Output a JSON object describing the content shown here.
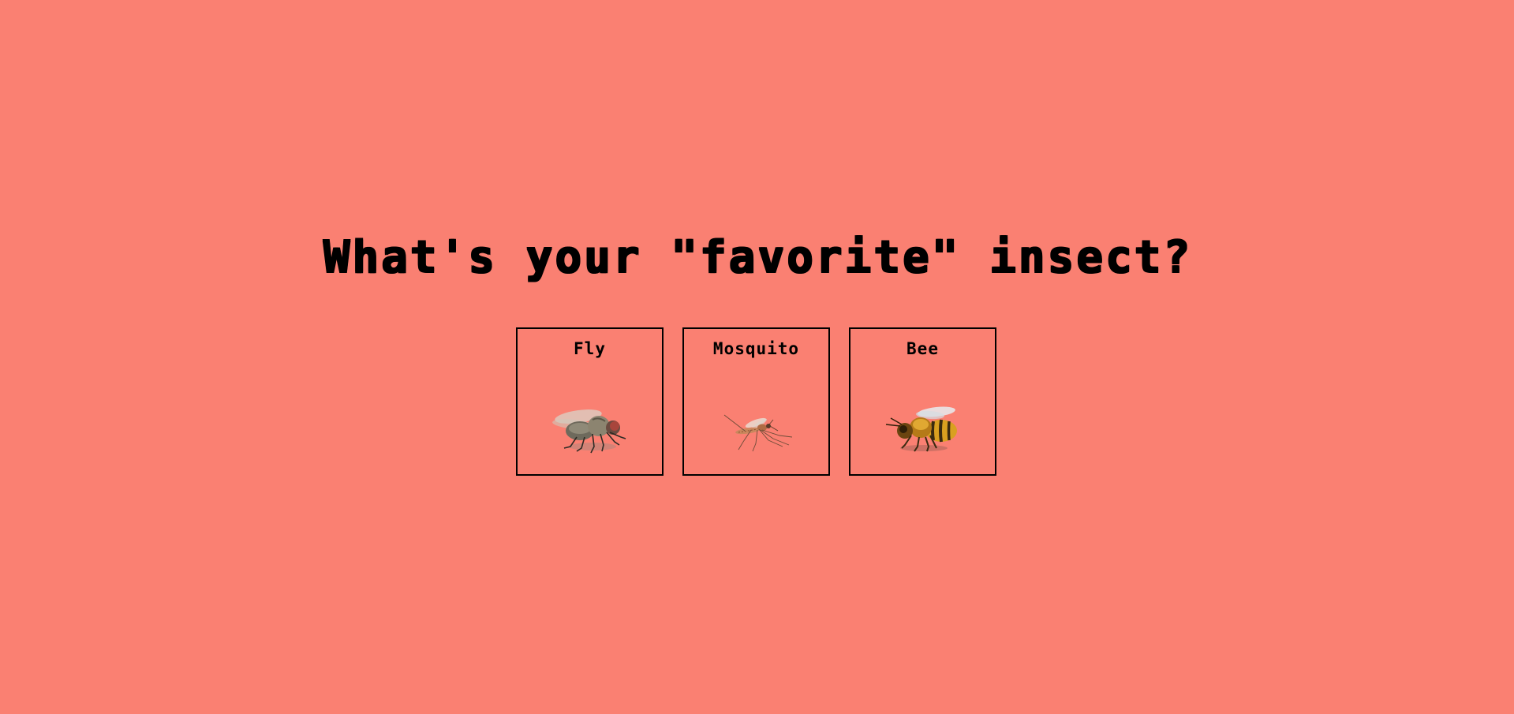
{
  "question": "What's your \"favorite\" insect?",
  "choices": [
    {
      "label": "Fly",
      "icon": "fly-icon"
    },
    {
      "label": "Mosquito",
      "icon": "mosquito-icon"
    },
    {
      "label": "Bee",
      "icon": "bee-icon"
    }
  ],
  "colors": {
    "background": "#fa8072",
    "text": "#000000",
    "border": "#000000"
  }
}
